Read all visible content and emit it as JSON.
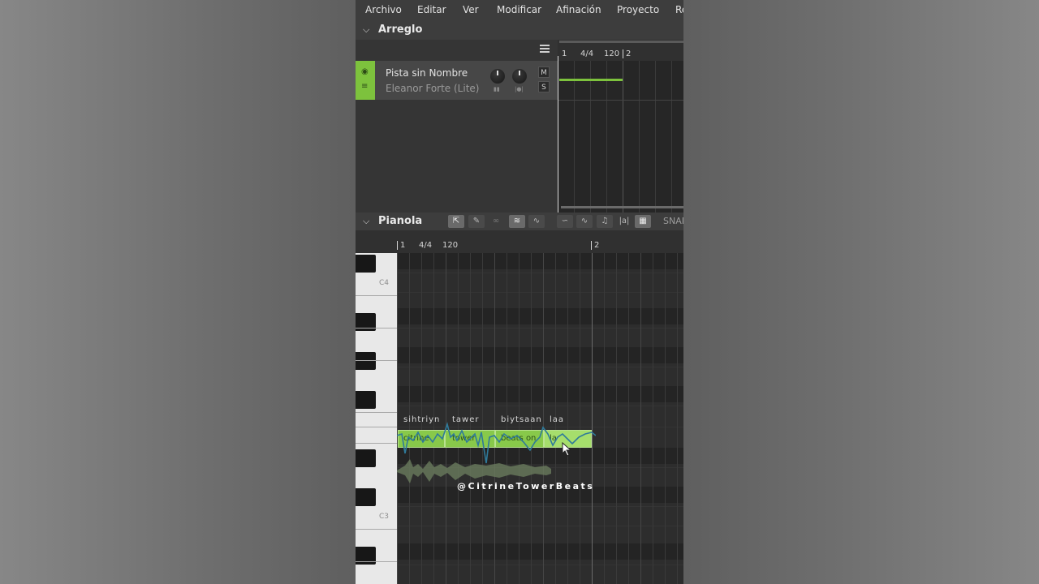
{
  "menu": [
    "Archivo",
    "Editar",
    "Ver",
    "Modificar",
    "Afinación",
    "Proyecto",
    "Re"
  ],
  "arrangement": {
    "title": "Arreglo",
    "ruler": {
      "bar1": "1",
      "time_sig": "4/4",
      "tempo": "120",
      "bar2": "2"
    },
    "track": {
      "name": "Pista sin Nombre",
      "voice": "Eleanor Forte (Lite)",
      "mute_label": "M",
      "solo_label": "S",
      "accent_color": "#7dc23d"
    }
  },
  "pianola": {
    "title": "Pianola",
    "ruler": {
      "bar1": "1",
      "time_sig": "4/4",
      "tempo": "120",
      "bar2": "2"
    },
    "snap_label": "SNAP",
    "key_labels": {
      "c4": "C4",
      "c3": "C3"
    },
    "phonemes": [
      "sihtriyn",
      "tawer",
      "biytsaan",
      "laa"
    ],
    "notes": [
      {
        "lyric": "citrine",
        "selected": false
      },
      {
        "lyric": "tower",
        "selected": false
      },
      {
        "lyric": "beats on",
        "selected": false
      },
      {
        "lyric": "la",
        "selected": true
      }
    ],
    "tools": [
      "select-tool",
      "pen-tool",
      "link-tool",
      "note-snap-tool",
      "pitch-draw-tool",
      "curve-tool",
      "vibrato-tool",
      "audio-tool",
      "lyrics-tool",
      "video-tool"
    ]
  },
  "watermark": "@CitrineTowerBeats",
  "note_color": "#88c94a"
}
